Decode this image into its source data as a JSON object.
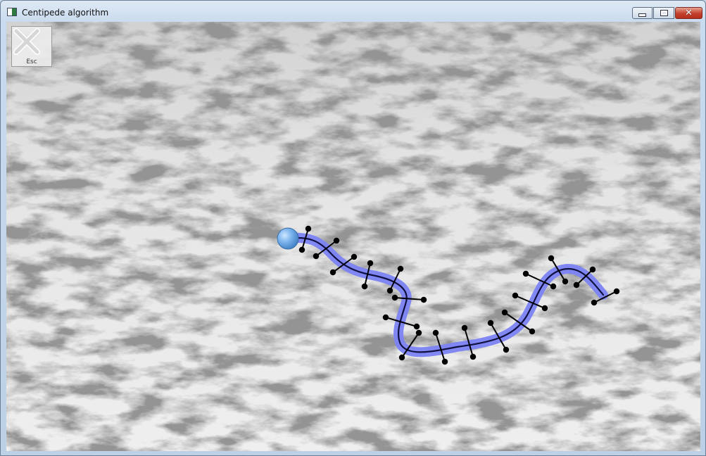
{
  "window": {
    "title": "Centipede algorithm",
    "buttons": {
      "minimize": "",
      "maximize": "",
      "close": "✕"
    }
  },
  "overlay": {
    "esc_label": "Esc"
  },
  "scene": {
    "colors": {
      "ground": "#e6e6e6",
      "vein": "#5a5a5a",
      "body_glow": "#7a86ff",
      "body_line": "#000000",
      "head": "#6aa8e6",
      "legs": "#000000"
    },
    "icons": [
      "app-icon",
      "minimize-icon",
      "maximize-icon",
      "close-icon",
      "esc-close-icon"
    ]
  }
}
